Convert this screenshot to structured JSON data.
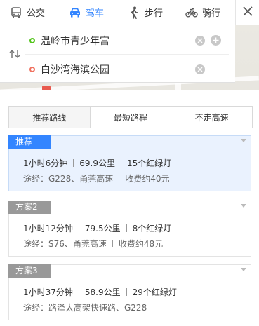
{
  "tabs": [
    {
      "label": "公交",
      "icon": "bus-icon"
    },
    {
      "label": "驾车",
      "icon": "car-icon",
      "active": true
    },
    {
      "label": "步行",
      "icon": "walk-icon"
    },
    {
      "label": "骑行",
      "icon": "bike-icon"
    }
  ],
  "inputs": {
    "start_value": "温岭市青少年宫",
    "end_value": "白沙湾海滨公园",
    "start_dot_color": "#52c41a",
    "end_dot_color": "#f0715f"
  },
  "strategies": [
    "推荐路线",
    "最短路程",
    "不走高速"
  ],
  "routes": [
    {
      "badge": "推荐",
      "time": "1小时6分钟",
      "distance": "69.9公里",
      "lights": "15个红绿灯",
      "via": "途经：G228、甬莞高速",
      "toll": "收费约40元"
    },
    {
      "badge": "方案2",
      "time": "1小时12分钟",
      "distance": "79.5公里",
      "lights": "8个红绿灯",
      "via": "途经：S76、甬莞高速",
      "toll": "收费约48元"
    },
    {
      "badge": "方案3",
      "time": "1小时37分钟",
      "distance": "58.9公里",
      "lights": "29个红绿灯",
      "via": "途经：路泽太高架快速路、G228",
      "toll": ""
    }
  ],
  "colors": {
    "accent": "#3385ff",
    "selected_bg": "#eaf2fe",
    "badge_gray": "#999999"
  }
}
